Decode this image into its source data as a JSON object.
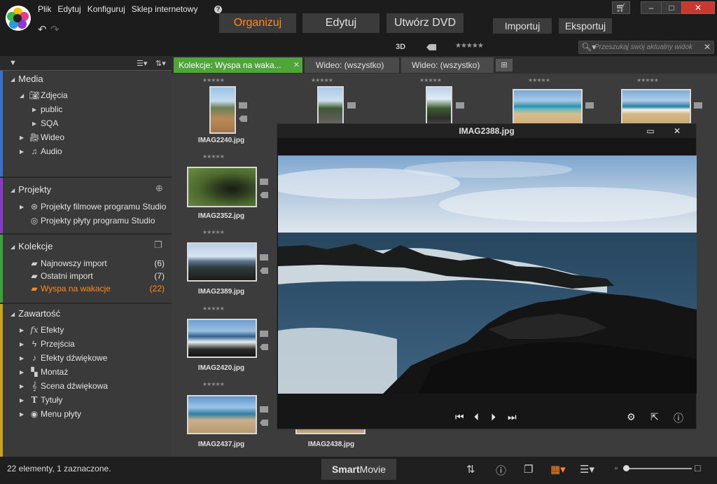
{
  "menu": {
    "items": [
      "Plik",
      "Edytuj",
      "Konfiguruj",
      "Sklep internetowy"
    ]
  },
  "main_tabs": [
    "Organizuj",
    "Edytuj",
    "Utwórz DVD"
  ],
  "secondary_buttons": [
    "Importuj",
    "Eksportuj"
  ],
  "toolbar": {
    "stereo_label": "3D",
    "rating_stars": "★★★★★",
    "search_placeholder": "Przeszukaj swój aktualny widok"
  },
  "sidebar": {
    "media": {
      "title": "Media",
      "items": [
        {
          "label": "Zdjęcia"
        },
        {
          "label": "public"
        },
        {
          "label": "SQA"
        },
        {
          "label": "Wideo"
        },
        {
          "label": "Audio"
        }
      ]
    },
    "projects": {
      "title": "Projekty",
      "items": [
        {
          "label": "Projekty filmowe programu Studio"
        },
        {
          "label": "Projekty płyty programu Studio"
        }
      ]
    },
    "collections": {
      "title": "Kolekcje",
      "items": [
        {
          "label": "Najnowszy import",
          "count": "(6)"
        },
        {
          "label": "Ostatni import",
          "count": "(7)"
        },
        {
          "label": "Wyspa na wakacje",
          "count": "(22)"
        }
      ]
    },
    "content": {
      "title": "Zawartość",
      "items": [
        {
          "label": "Efekty"
        },
        {
          "label": "Przejścia"
        },
        {
          "label": "Efekty dźwiękowe"
        },
        {
          "label": "Montaż"
        },
        {
          "label": "Scena dźwiękowa"
        },
        {
          "label": "Tytuły"
        },
        {
          "label": "Menu płyty"
        }
      ]
    }
  },
  "content_tabs": [
    {
      "label": "Kolekcje: Wyspa na waka..."
    },
    {
      "label": "Wideo: (wszystko)"
    },
    {
      "label": "Wideo: (wszystko)"
    }
  ],
  "tiles": [
    {
      "name": "IMAG2240.jpg"
    },
    {
      "name": "IMAG2352.jpg"
    },
    {
      "name": "IMAG2389.jpg"
    },
    {
      "name": "IMAG2420.jpg"
    },
    {
      "name": "IMAG2437.jpg"
    },
    {
      "name": "IMAG2438.jpg"
    }
  ],
  "preview": {
    "title": "IMAG2388.jpg"
  },
  "status": {
    "text": "22 elementy, 1 zaznaczone.",
    "smartmovie_bold": "Smart",
    "smartmovie_rest": "Movie"
  }
}
